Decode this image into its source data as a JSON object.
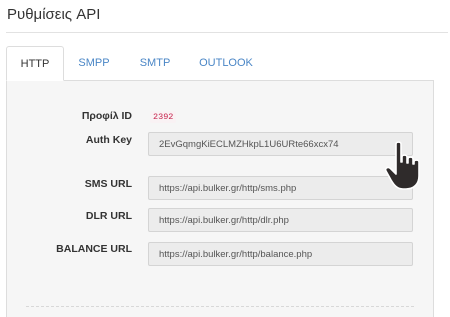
{
  "header": {
    "title": "Ρυθμίσεις API"
  },
  "tabs": [
    {
      "label": "HTTP",
      "active": true
    },
    {
      "label": "SMPP"
    },
    {
      "label": "SMTP"
    },
    {
      "label": "OUTLOOK"
    }
  ],
  "form": {
    "profile_id_label": "Προφίλ ID",
    "profile_id_value": "2392",
    "auth_key_label": "Auth Key",
    "auth_key_value": "2EvGqmgKiECLMZHkpL1U6URte66xcx74",
    "sms_url_label": "SMS URL",
    "sms_url_value": "https://api.bulker.gr/http/sms.php",
    "dlr_url_label": "DLR URL",
    "dlr_url_value": "https://api.bulker.gr/http/dlr.php",
    "balance_url_label": "BALANCE URL",
    "balance_url_value": "https://api.bulker.gr/http/balance.php"
  },
  "colors": {
    "link": "#4a86c6",
    "badge_text": "#c7254e",
    "panel_bg": "#f6f6f6"
  },
  "icons": {
    "cursor": "hand-pointer-icon"
  }
}
